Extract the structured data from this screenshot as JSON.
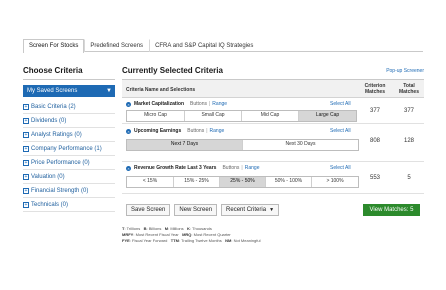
{
  "tabs": [
    {
      "label": "Screen For Stocks",
      "active": true
    },
    {
      "label": "Predefined Screens",
      "active": false
    },
    {
      "label": "CFRA and S&P Capital IQ Strategies",
      "active": false
    }
  ],
  "left": {
    "title": "Choose Criteria",
    "saved_screens": "My Saved Screens",
    "items": [
      {
        "label": "Basic Criteria (2)"
      },
      {
        "label": "Dividends (0)"
      },
      {
        "label": "Analyst Ratings (0)"
      },
      {
        "label": "Company Performance (1)"
      },
      {
        "label": "Price Performance (0)"
      },
      {
        "label": "Valuation (0)"
      },
      {
        "label": "Financial Strength (0)"
      },
      {
        "label": "Technicals (0)"
      }
    ]
  },
  "main": {
    "title": "Currently Selected Criteria",
    "popup_link": "Pop-up Screener",
    "columns": {
      "name": "Criteria Name and Selections",
      "criterion_matches": "Criterion Matches",
      "total_matches": "Total Matches"
    },
    "criteria": [
      {
        "name": "Market Capitalization",
        "buttons_label": "Buttons",
        "range_label": "Range",
        "select_all": "Select All",
        "options": [
          {
            "label": "Micro Cap",
            "selected": false
          },
          {
            "label": "Small Cap",
            "selected": false
          },
          {
            "label": "Mid Cap",
            "selected": false
          },
          {
            "label": "Large Cap",
            "selected": true
          }
        ],
        "criterion_matches": "377",
        "total_matches": "377"
      },
      {
        "name": "Upcoming Earnings",
        "buttons_label": "Buttons",
        "range_label": "Range",
        "select_all": "Select All",
        "options": [
          {
            "label": "Next 7 Days",
            "selected": true
          },
          {
            "label": "Next 30 Days",
            "selected": false
          }
        ],
        "criterion_matches": "808",
        "total_matches": "128"
      },
      {
        "name": "Revenue Growth Rate Last 3 Years",
        "buttons_label": "Buttons",
        "range_label": "Range",
        "select_all": "Select All",
        "options": [
          {
            "label": "< 15%",
            "selected": false
          },
          {
            "label": "15% - 25%",
            "selected": false
          },
          {
            "label": "25% - 50%",
            "selected": true
          },
          {
            "label": "50% - 100%",
            "selected": false
          },
          {
            "label": "> 100%",
            "selected": false
          }
        ],
        "criterion_matches": "553",
        "total_matches": "5"
      }
    ],
    "save_screen": "Save Screen",
    "new_screen": "New Screen",
    "recent_criteria": "Recent Criteria",
    "view_matches": "View Matches: 5"
  },
  "legend": {
    "line1": [
      {
        "k": "T",
        "v": "Trillions"
      },
      {
        "k": "B",
        "v": "Billions"
      },
      {
        "k": "M",
        "v": "Millions"
      },
      {
        "k": "K",
        "v": "Thousands"
      }
    ],
    "line2": [
      {
        "k": "MRFY",
        "v": "Most Recent Fiscal Year"
      },
      {
        "k": "MRQ",
        "v": "Most Recent Quarter"
      }
    ],
    "line3": [
      {
        "k": "FYE",
        "v": "Fiscal Year Forward"
      },
      {
        "k": "TTM",
        "v": "Trailing Twelve Months"
      },
      {
        "k": "NM",
        "v": "Not Meaningful"
      }
    ]
  },
  "colors": {
    "accent": "#1e6ab4",
    "view_button": "#2c8a2c"
  }
}
